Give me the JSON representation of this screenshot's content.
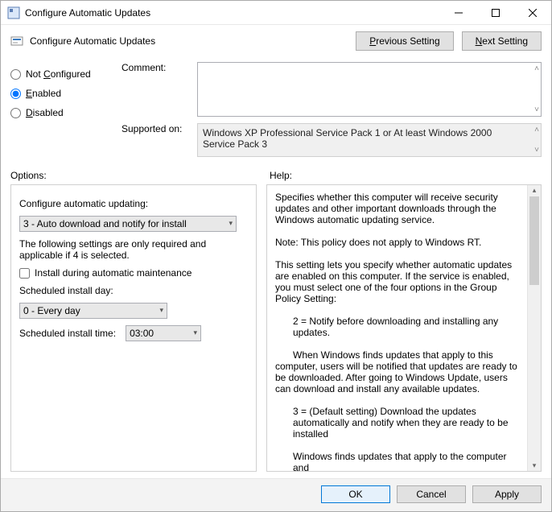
{
  "window": {
    "title": "Configure Automatic Updates"
  },
  "subheader": {
    "title": "Configure Automatic Updates",
    "previous": "Previous Setting",
    "next": "Next Setting",
    "prev_ul": "P",
    "next_ul": "N"
  },
  "radios": {
    "not_configured": "Not Configured",
    "enabled": "Enabled",
    "disabled": "Disabled",
    "nc_ul": "C",
    "en_ul": "E",
    "di_ul": "D",
    "selected": "enabled"
  },
  "labels": {
    "comment": "Comment:",
    "supported": "Supported on:",
    "options": "Options:",
    "help": "Help:"
  },
  "supported_on": "Windows XP Professional Service Pack 1 or At least Windows 2000 Service Pack 3",
  "options": {
    "configure_label": "Configure automatic updating:",
    "configure_value": "3 - Auto download and notify for install",
    "note": "The following settings are only required and applicable if 4 is selected.",
    "install_maintenance": "Install during automatic maintenance",
    "day_label": "Scheduled install day:",
    "day_value": "0 - Every day",
    "time_label": "Scheduled install time:",
    "time_value": "03:00"
  },
  "help": {
    "p1": "Specifies whether this computer will receive security updates and other important downloads through the Windows automatic updating service.",
    "p2": "Note: This policy does not apply to Windows RT.",
    "p3": "This setting lets you specify whether automatic updates are enabled on this computer. If the service is enabled, you must select one of the four options in the Group Policy Setting:",
    "p4": "2 = Notify before downloading and installing any updates.",
    "p5": "When Windows finds updates that apply to this computer, users will be notified that updates are ready to be downloaded. After going to Windows Update, users can download and install any available updates.",
    "p6": "3 = (Default setting) Download the updates automatically and notify when they are ready to be installed",
    "p7": "Windows finds updates that apply to the computer and"
  },
  "footer": {
    "ok": "OK",
    "cancel": "Cancel",
    "apply": "Apply"
  }
}
